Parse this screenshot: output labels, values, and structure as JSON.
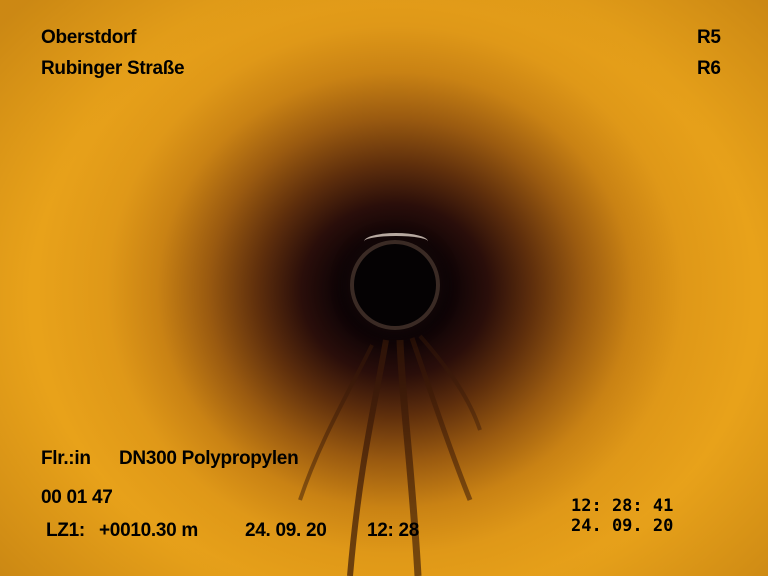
{
  "osd": {
    "location": "Oberstdorf",
    "street": "Rubinger Straße",
    "from_manhole": "R5",
    "to_manhole": "R6",
    "flow_direction": "Flr.:in",
    "pipe": "DN300 Polypropylen",
    "elapsed": "00 01 47",
    "counter_label": "LZ1:",
    "counter_value": "+0010.30 m",
    "counter_date": "24. 09. 20",
    "counter_time": "12: 28",
    "clock_time": "12: 28: 41",
    "clock_date": "24. 09. 20"
  },
  "colors": {
    "pipe_wall": "#e8a21a",
    "pipe_center": "#000000",
    "text": "#000000"
  }
}
